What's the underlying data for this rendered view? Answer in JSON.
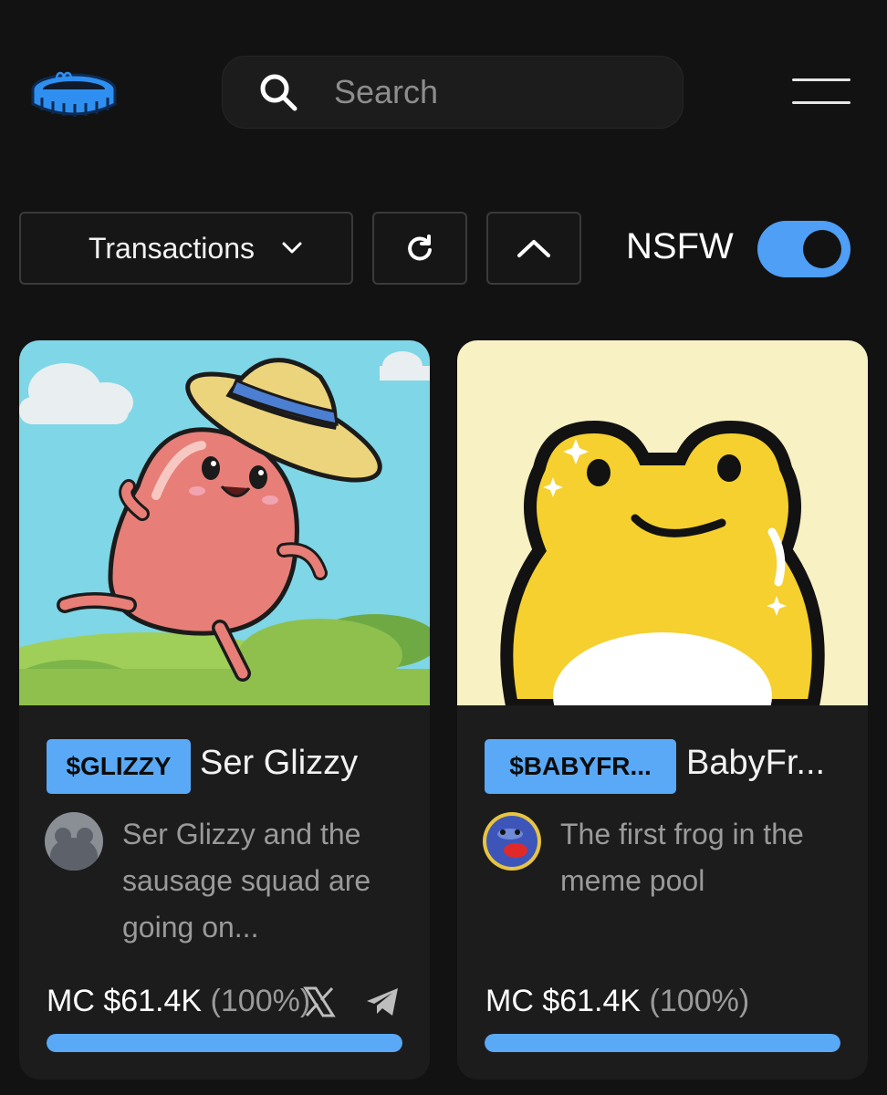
{
  "header": {
    "logo_icon": "pool-icon",
    "search_placeholder": "Search",
    "search_icon": "search-icon",
    "menu_icon": "hamburger-menu-icon"
  },
  "controls": {
    "sort_label": "Transactions",
    "sort_icon": "chevron-down-icon",
    "refresh_icon": "refresh-icon",
    "collapse_icon": "chevron-up-icon",
    "nsfw_label": "NSFW",
    "nsfw_enabled": true
  },
  "colors": {
    "accent": "#5aa9f6",
    "background": "#121212",
    "card": "#1c1c1c"
  },
  "tokens": [
    {
      "ticker": "$GLIZZY",
      "name": "Ser Glizzy",
      "description": "Ser Glizzy and the sausage squad are going on...",
      "mc_label": "MC $61.4K",
      "mc_percent": "(100%)",
      "progress": 1.0,
      "socials": [
        "x-icon",
        "telegram-icon"
      ]
    },
    {
      "ticker": "$BABYFR...",
      "name": "BabyFr...",
      "description": "The first frog in the meme pool",
      "mc_label": "MC $61.4K",
      "mc_percent": "(100%)",
      "progress": 1.0,
      "socials": []
    }
  ]
}
